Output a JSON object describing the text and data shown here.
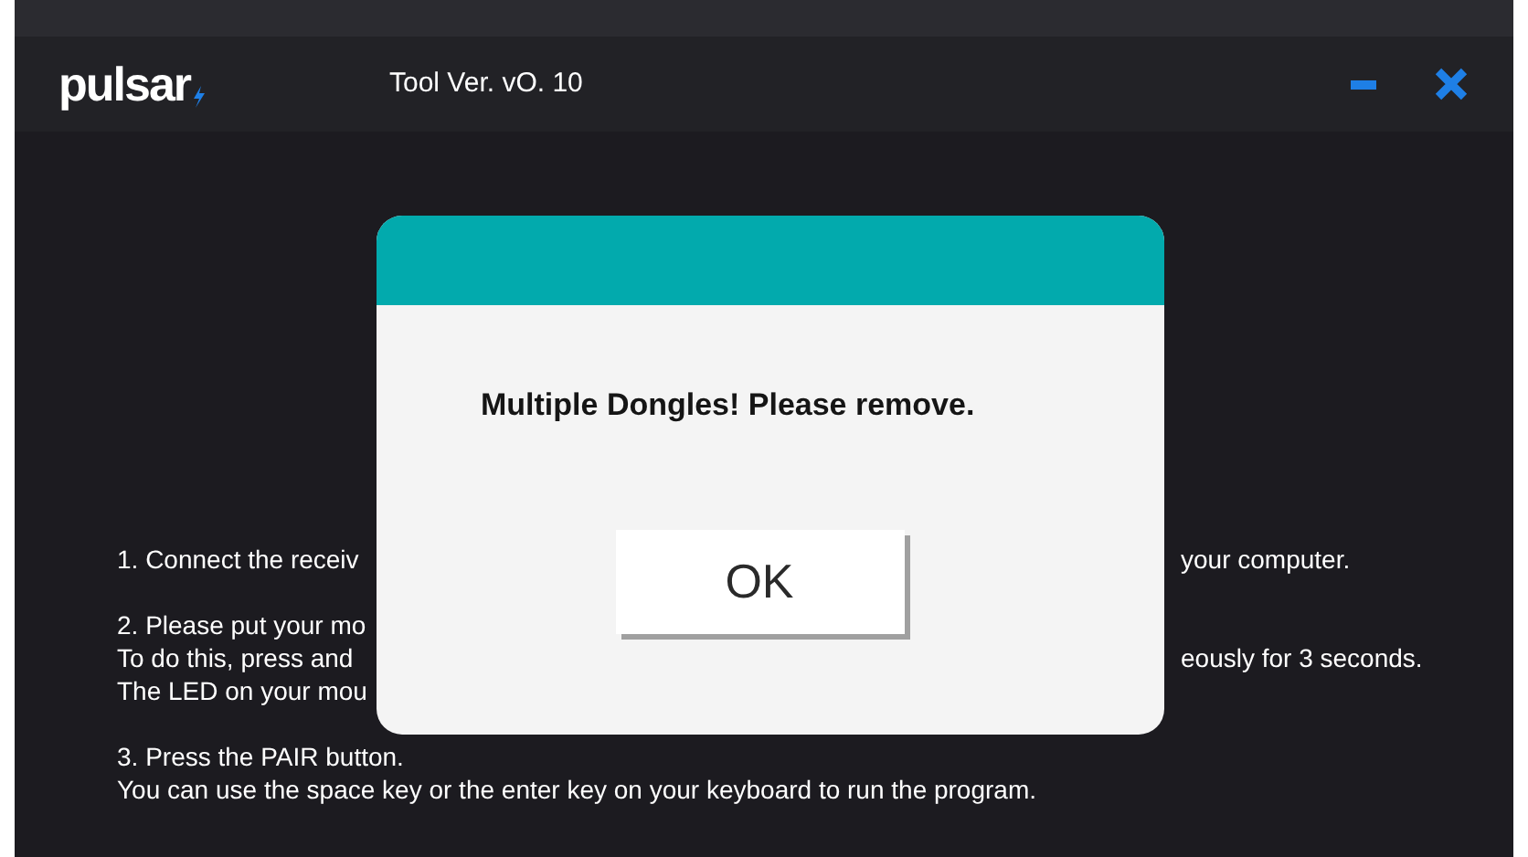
{
  "window": {
    "logo": "pulsar",
    "title": "Tool Ver. vO. 10"
  },
  "instructions": [
    {
      "lines": [
        {
          "left": "1. Connect the receiv",
          "right": "your computer."
        }
      ]
    },
    {
      "lines": [
        {
          "left": "2. Please put your mo"
        },
        {
          "left": "To do this, press and",
          "right": "eously for 3 seconds."
        },
        {
          "left": "The LED on your mou"
        }
      ]
    },
    {
      "lines": [
        {
          "left": "3. Press the PAIR button."
        },
        {
          "left": "You can use the space key or the enter key on your keyboard to run the program."
        }
      ]
    }
  ],
  "dialog": {
    "message": "Multiple Dongles! Please remove.",
    "button": "OK"
  }
}
